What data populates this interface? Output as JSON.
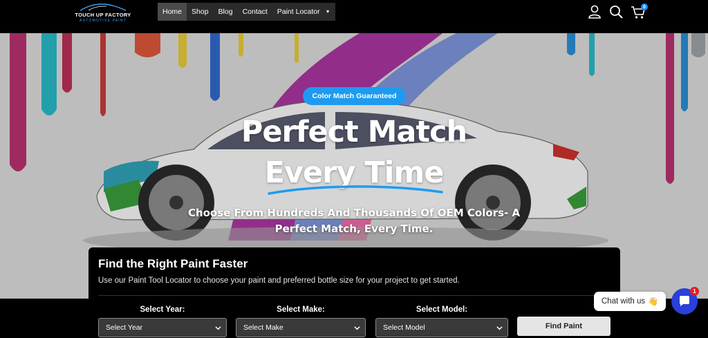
{
  "header": {
    "logo": {
      "title": "TOUCH UP FACTORY",
      "subtitle": "AUTOMOTIVE PAINT"
    },
    "nav": [
      {
        "label": "Home",
        "active": true
      },
      {
        "label": "Shop"
      },
      {
        "label": "Blog"
      },
      {
        "label": "Contact"
      },
      {
        "label": "Paint Locator",
        "dropdown": true
      }
    ],
    "icons": [
      "user-icon",
      "search-icon",
      "cart-icon"
    ],
    "cart_count": "0"
  },
  "hero": {
    "badge": "Color Match Guaranteed",
    "headline_line1": "Perfect Match",
    "headline_line2": "Every Time",
    "subheadline": "Choose From Hundreds And Thousands Of OEM Colors- A Perfect Match, Every Time."
  },
  "finder": {
    "title": "Find the Right Paint Faster",
    "description": "Use our Paint Tool Locator to choose your paint and preferred bottle size for your project to get started.",
    "year": {
      "label": "Select Year:",
      "value": "Select Year"
    },
    "make": {
      "label": "Select Make:",
      "value": "Select Make"
    },
    "model": {
      "label": "Select Model:",
      "value": "Select Model"
    },
    "button": "Find Paint"
  },
  "chat": {
    "label": "Chat with us",
    "emoji": "👋",
    "unread": "1"
  },
  "colors": {
    "accent_blue": "#1e9bf0",
    "chat_blue": "#2a40d8",
    "badge_red": "#e0202a"
  }
}
